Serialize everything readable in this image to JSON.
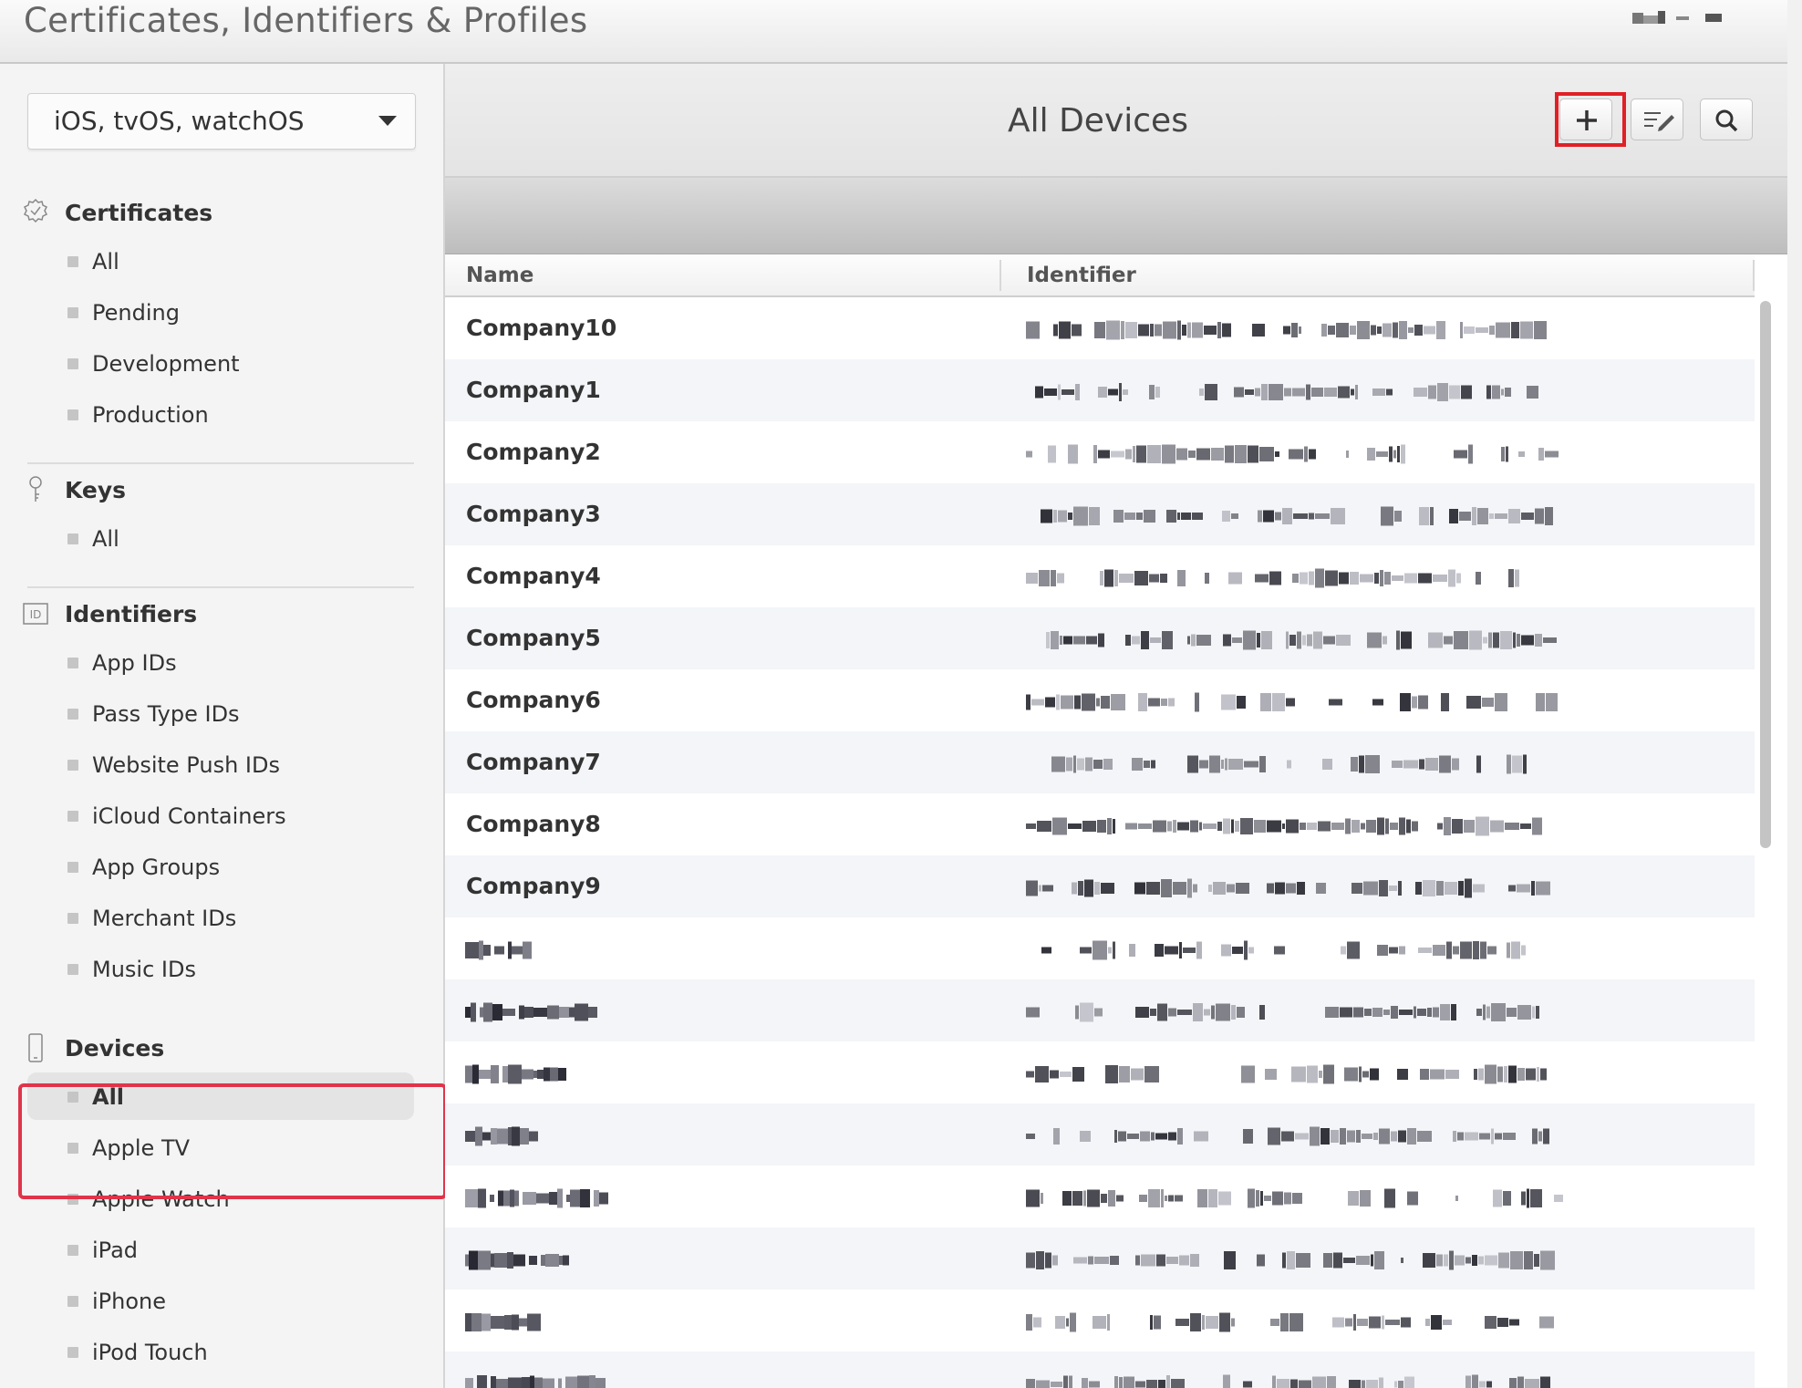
{
  "header": {
    "title": "Certificates, Identifiers & Profiles"
  },
  "colors": {
    "highlight": "#e0344a",
    "add_highlight": "#e02026"
  },
  "sidebar": {
    "platform_selector": {
      "value": "iOS, tvOS, watchOS",
      "icon": "caret-down-icon"
    },
    "sections": [
      {
        "title": "Certificates",
        "icon": "certificate-badge-icon",
        "items": [
          {
            "label": "All"
          },
          {
            "label": "Pending"
          },
          {
            "label": "Development"
          },
          {
            "label": "Production"
          }
        ]
      },
      {
        "title": "Keys",
        "icon": "key-icon",
        "items": [
          {
            "label": "All"
          }
        ]
      },
      {
        "title": "Identifiers",
        "icon": "id-badge-icon",
        "items": [
          {
            "label": "App IDs"
          },
          {
            "label": "Pass Type IDs"
          },
          {
            "label": "Website Push IDs"
          },
          {
            "label": "iCloud Containers"
          },
          {
            "label": "App Groups"
          },
          {
            "label": "Merchant IDs"
          },
          {
            "label": "Music IDs"
          }
        ]
      },
      {
        "title": "Devices",
        "icon": "device-phone-icon",
        "items": [
          {
            "label": "All",
            "selected": true
          },
          {
            "label": "Apple TV"
          },
          {
            "label": "Apple Watch"
          },
          {
            "label": "iPad"
          },
          {
            "label": "iPhone"
          },
          {
            "label": "iPod Touch"
          }
        ]
      }
    ]
  },
  "main": {
    "title": "All Devices",
    "toolbar": [
      {
        "icon": "plus-icon",
        "highlighted": true
      },
      {
        "icon": "edit-list-icon"
      },
      {
        "icon": "search-icon"
      }
    ],
    "table": {
      "columns": [
        "Name",
        "Identifier"
      ],
      "rows": [
        {
          "name": "Company10"
        },
        {
          "name": "Company1"
        },
        {
          "name": "Company2"
        },
        {
          "name": "Company3"
        },
        {
          "name": "Company4"
        },
        {
          "name": "Company5"
        },
        {
          "name": "Company6"
        },
        {
          "name": "Company7"
        },
        {
          "name": "Company8"
        },
        {
          "name": "Company9"
        },
        {
          "name": ""
        },
        {
          "name": ""
        },
        {
          "name": ""
        },
        {
          "name": ""
        },
        {
          "name": ""
        },
        {
          "name": ""
        },
        {
          "name": ""
        },
        {
          "name": ""
        }
      ]
    }
  }
}
